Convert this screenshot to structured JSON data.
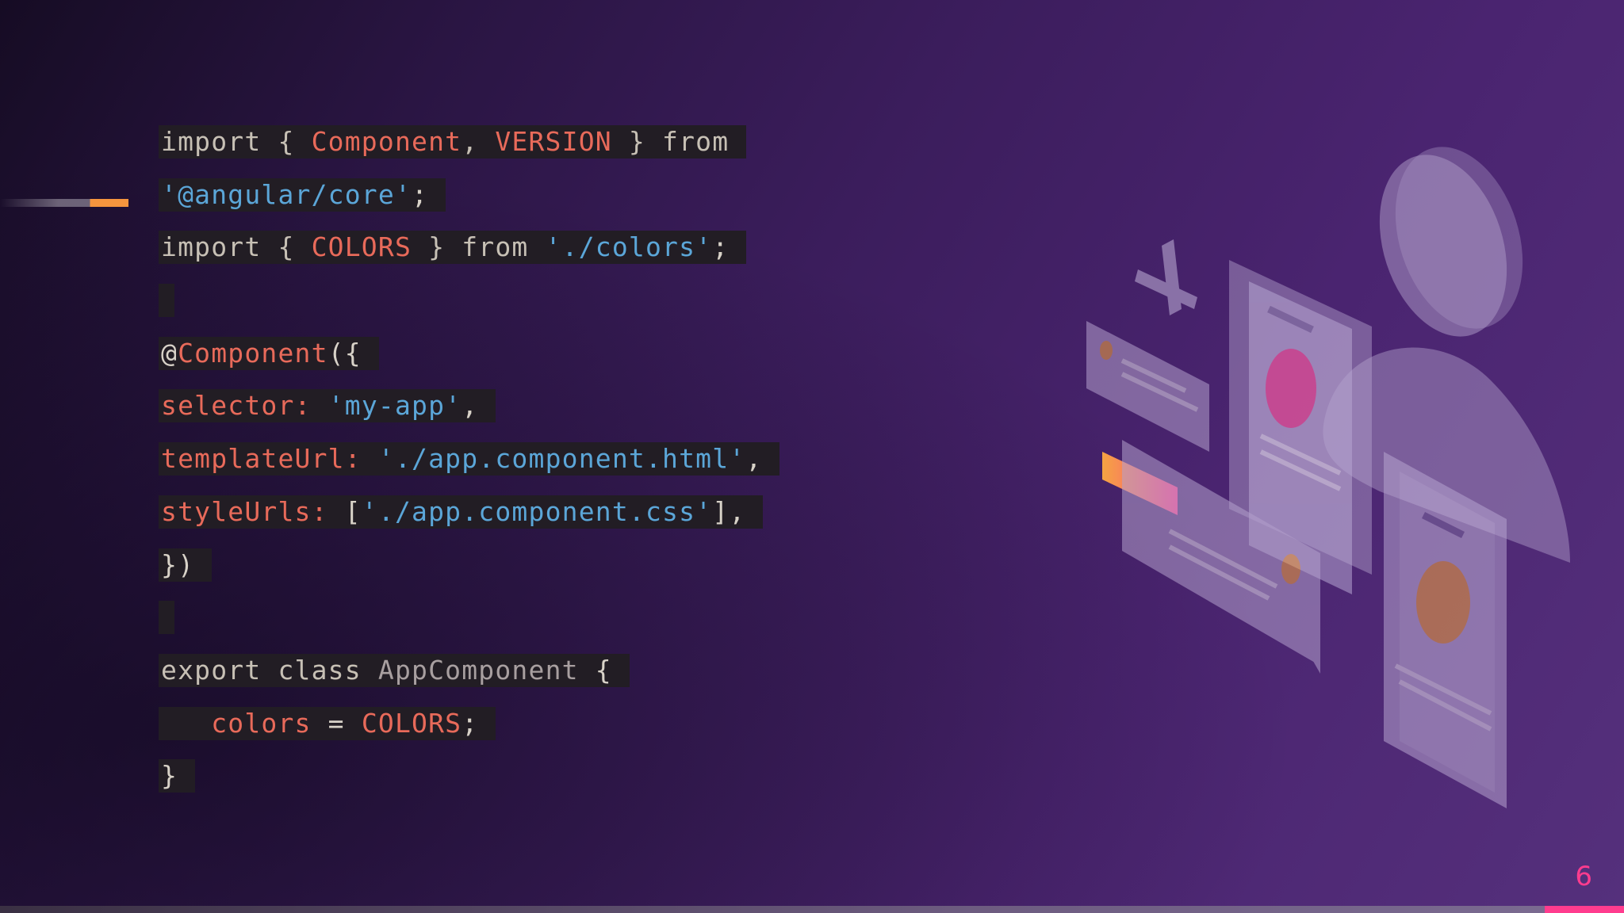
{
  "slide": {
    "page_number": "6"
  },
  "code_lines": [
    {
      "parts": [
        {
          "t": "import { ",
          "c": "kw"
        },
        {
          "t": "Component",
          "c": "id"
        },
        {
          "t": ", ",
          "c": "kw"
        },
        {
          "t": "VERSION",
          "c": "id"
        },
        {
          "t": " } from",
          "c": "kw"
        }
      ]
    },
    {
      "parts": [
        {
          "t": "'@angular/core'",
          "c": "str"
        },
        {
          "t": ";",
          "c": "plain"
        }
      ]
    },
    {
      "parts": [
        {
          "t": "import { ",
          "c": "kw"
        },
        {
          "t": "COLORS",
          "c": "id"
        },
        {
          "t": " } from ",
          "c": "kw"
        },
        {
          "t": "'./colors'",
          "c": "str"
        },
        {
          "t": ";",
          "c": "plain"
        }
      ]
    },
    {
      "parts": []
    },
    {
      "parts": [
        {
          "t": "@",
          "c": "plain"
        },
        {
          "t": "Component",
          "c": "id"
        },
        {
          "t": "({",
          "c": "plain"
        }
      ]
    },
    {
      "parts": [
        {
          "t": "selector: ",
          "c": "id"
        },
        {
          "t": "'my-app'",
          "c": "str"
        },
        {
          "t": ",",
          "c": "plain"
        }
      ]
    },
    {
      "parts": [
        {
          "t": "templateUrl: ",
          "c": "id"
        },
        {
          "t": "'./app.component.html'",
          "c": "str"
        },
        {
          "t": ",",
          "c": "plain"
        }
      ]
    },
    {
      "parts": [
        {
          "t": "styleUrls: ",
          "c": "id"
        },
        {
          "t": "[",
          "c": "plain"
        },
        {
          "t": "'./app.component.css'",
          "c": "str"
        },
        {
          "t": "],",
          "c": "plain"
        }
      ]
    },
    {
      "parts": [
        {
          "t": "})",
          "c": "plain"
        }
      ]
    },
    {
      "parts": []
    },
    {
      "parts": [
        {
          "t": "export class ",
          "c": "kw"
        },
        {
          "t": "AppComponent",
          "c": "cls"
        },
        {
          "t": " {",
          "c": "plain"
        }
      ]
    },
    {
      "parts": [
        {
          "t": "   colors",
          "c": "id"
        },
        {
          "t": " = ",
          "c": "plain"
        },
        {
          "t": "COLORS",
          "c": "id"
        },
        {
          "t": ";",
          "c": "plain"
        }
      ]
    },
    {
      "parts": [
        {
          "t": "}",
          "c": "plain"
        }
      ]
    }
  ],
  "colors": {
    "accent_orange": "#f5953e",
    "accent_pink": "#ff3c8e",
    "code_bg": "#221d24",
    "string": "#5ba6d8",
    "identifier": "#e86a5a",
    "keyword": "#c7c0b5"
  },
  "illustration": {
    "icons": [
      "user-profile-icon",
      "plus-icon",
      "profile-card-icon"
    ]
  }
}
